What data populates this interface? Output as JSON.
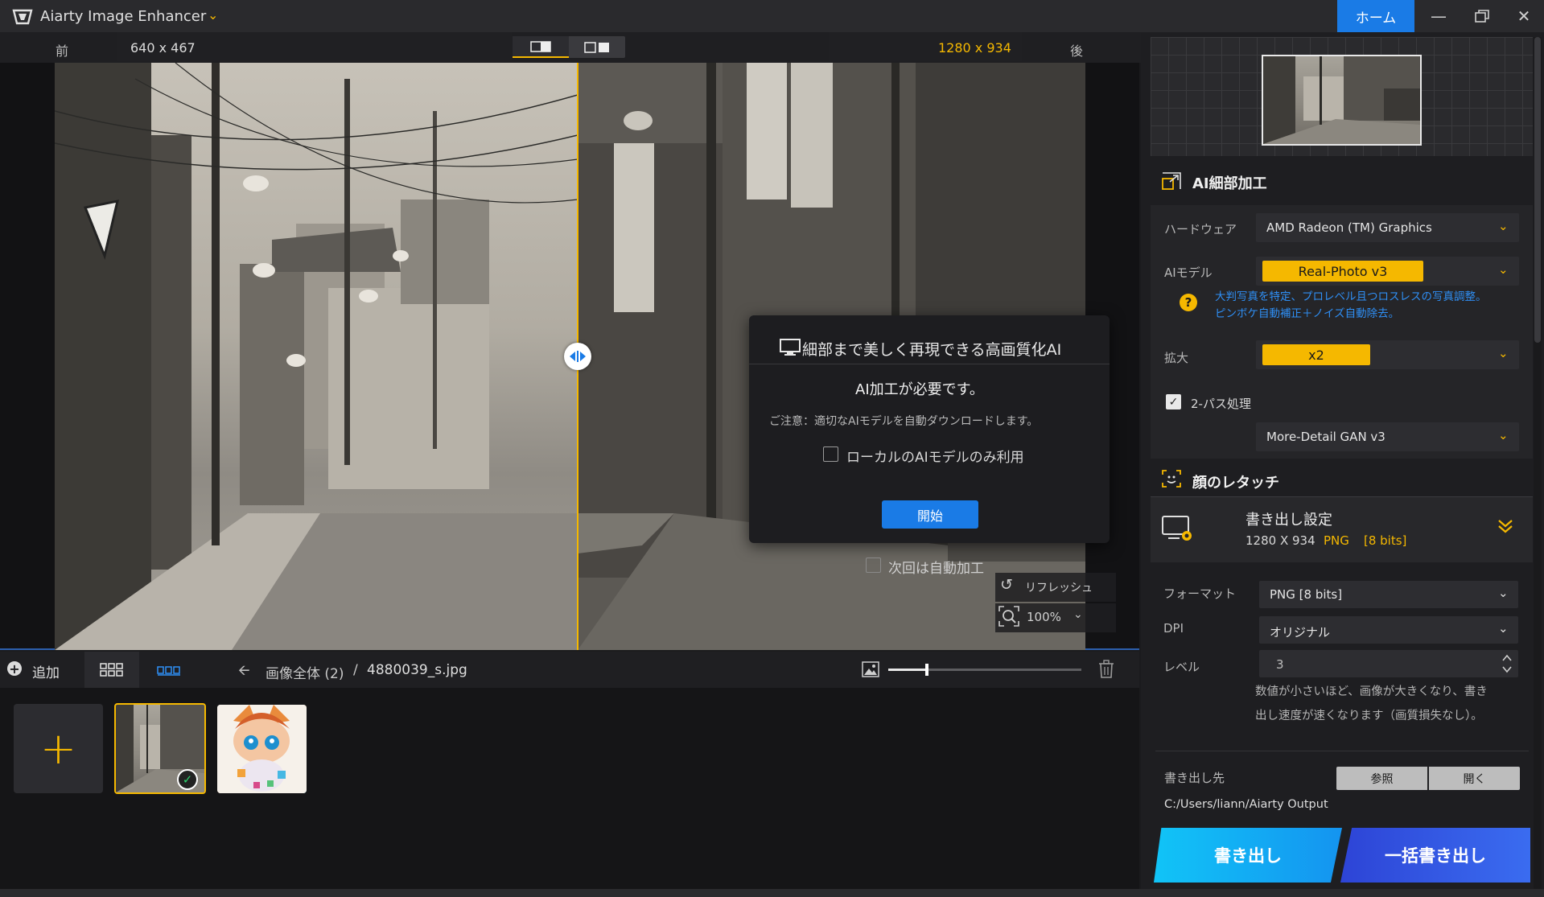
{
  "titlebar": {
    "app_title": "Aiarty Image Enhancer",
    "home_label": "ホーム",
    "icons": [
      "app-logo-icon",
      "chevron-down-icon",
      "minimize-icon",
      "restore-icon",
      "close-icon"
    ]
  },
  "compare": {
    "before_label": "前",
    "after_label": "後",
    "before_resolution": "640 x 467",
    "after_resolution": "1280 x 934"
  },
  "dialog": {
    "title": "細部まで美しく再現できる高画質化AI",
    "message": "AI加工が必要です。",
    "note": "ご注意：適切なAIモデルを自動ダウンロードします。",
    "local_only_label": "ローカルのAIモデルのみ利用",
    "start_label": "開始",
    "auto_next_label": "次回は自動加工"
  },
  "viewer_controls": {
    "refresh_label": "リフレッシュ",
    "zoom_value": "100%"
  },
  "toolbar": {
    "add_label": "追加",
    "breadcrumb_all": "画像全体 (2)",
    "breadcrumb_sep": "/",
    "breadcrumb_file": "4880039_s.jpg",
    "thumbnail_size_fraction": 0.2
  },
  "thumbnails": {
    "add_tile_symbol": "+",
    "check_symbol": "✓"
  },
  "right_panel": {
    "ai_section_title": "AI細部加工",
    "hardware_label": "ハードウェア",
    "hardware_value": "AMD Radeon (TM) Graphics",
    "ai_model_label": "AIモデル",
    "ai_model_value": "Real-Photo  v3",
    "model_desc_line1": "大判写真を特定、プロレベル且つロスレスの写真調整。",
    "model_desc_line2": "ピンボケ自動補正＋ノイズ自動除去。",
    "scale_label": "拡大",
    "scale_value": "x2",
    "twopass_label": "2-パス処理",
    "twopass_model": "More-Detail GAN  v3",
    "face_section_title": "顔のレタッチ",
    "export_title": "書き出し設定",
    "export_dims": "1280 X 934",
    "export_format": "PNG",
    "export_bits": "[8 bits]",
    "format_label": "フォーマット",
    "format_value": "PNG   [8 bits]",
    "dpi_label": "DPI",
    "dpi_value": "オリジナル",
    "level_label": "レベル",
    "level_value": "3",
    "level_help_line1": "数値が小さいほど、画像が大きくなり、書き",
    "level_help_line2": "出し速度が速くなります（画質損失なし）。",
    "dest_label": "書き出し先",
    "browse_label": "参照",
    "open_label": "開く",
    "dest_path": "C:/Users/liann/Aiarty Output",
    "export_btn": "書き出し",
    "batch_export_btn": "一括書き出し"
  },
  "colors": {
    "accent": "#f5b800",
    "primary_blue": "#1a7be6",
    "export_cyan": "#11c4f7",
    "batch_blue": "#2d44d6",
    "link_blue": "#2f8ff5"
  }
}
